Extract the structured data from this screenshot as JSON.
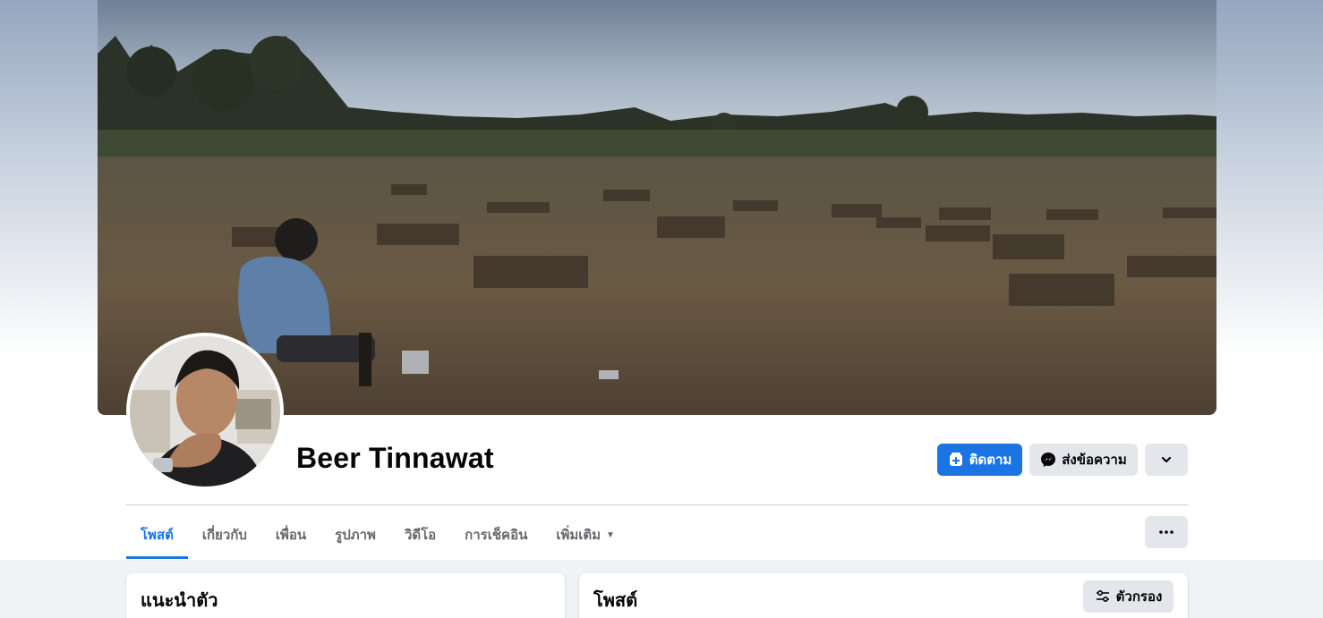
{
  "profile": {
    "name": "Beer Tinnawat"
  },
  "actions": {
    "follow_label": "ติดตาม",
    "message_label": "ส่งข้อความ",
    "more_icon": "chevron-down-icon"
  },
  "tabs": [
    {
      "label": "โพสต์",
      "active": true
    },
    {
      "label": "เกี่ยวกับ",
      "active": false
    },
    {
      "label": "เพื่อน",
      "active": false
    },
    {
      "label": "รูปภาพ",
      "active": false
    },
    {
      "label": "วิดีโอ",
      "active": false
    },
    {
      "label": "การเช็คอิน",
      "active": false
    },
    {
      "label": "เพิ่มเติม",
      "active": false
    }
  ],
  "tabs_more_icon": "ellipsis-icon",
  "intro_card": {
    "title": "แนะนำตัว"
  },
  "posts_card": {
    "title": "โพสต์",
    "filter_label": "ตัวกรอง"
  },
  "colors": {
    "accent": "#1b74e4",
    "button_gray": "#e4e6eb",
    "page_bg": "#f0f2f5"
  }
}
